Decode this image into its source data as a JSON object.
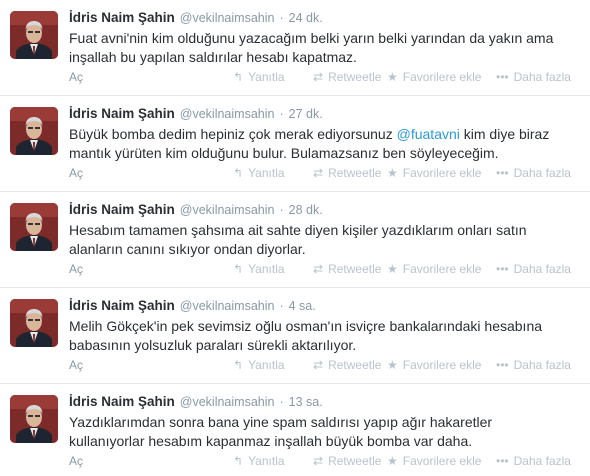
{
  "tweets": [
    {
      "name": "İdris Naim Şahin",
      "handle": "@vekilnaimsahin",
      "time": "24 dk.",
      "text_parts": [
        "Fuat avni'nin kim olduğunu yazacağım belki yarın belki yarından da yakın ama inşallah bu yapılan saldırılar hesabı kapatmaz."
      ]
    },
    {
      "name": "İdris Naim Şahin",
      "handle": "@vekilnaimsahin",
      "time": "27 dk.",
      "text_before": "Büyük bomba dedim hepiniz çok merak ediyorsunuz ",
      "mention": "@fuatavni",
      "text_after": " kim diye biraz mantık yürüten kim olduğunu bulur. Bulamazsanız ben söyleyeceğim."
    },
    {
      "name": "İdris Naim Şahin",
      "handle": "@vekilnaimsahin",
      "time": "28 dk.",
      "text_parts": [
        "Hesabım tamamen şahsıma ait sahte diyen kişiler yazdıklarım onları satın alanların canını sıkıyor ondan diyorlar."
      ]
    },
    {
      "name": "İdris Naim Şahin",
      "handle": "@vekilnaimsahin",
      "time": "4 sa.",
      "text_parts": [
        "Melih Gökçek'in pek sevimsiz oğlu osman'ın isviçre bankalarındaki hesabına babasının yolsuzluk paraları sürekli aktarılıyor."
      ]
    },
    {
      "name": "İdris Naim Şahin",
      "handle": "@vekilnaimsahin",
      "time": "13 sa.",
      "text_parts": [
        "Yazdıklarımdan sonra bana yine spam saldırısı yapıp ağır hakaretler kullanıyorlar hesabım kapanmaz inşallah büyük bomba var daha."
      ]
    }
  ],
  "separator": "·",
  "actions": {
    "expand": "Aç",
    "reply": "Yanıtla",
    "retweet": "Retweetle",
    "favorite": "Favorilere ekle",
    "more": "Daha fazla"
  },
  "icons": {
    "reply": "reply-arrow-icon",
    "retweet": "retweet-icon",
    "favorite": "star-icon",
    "more": "ellipsis-icon"
  },
  "colors": {
    "name": "#292f33",
    "meta": "#8899a6",
    "mention": "#2b9bd6",
    "action": "#b8c4cc",
    "avatar_bg": "#7d2a2a"
  }
}
